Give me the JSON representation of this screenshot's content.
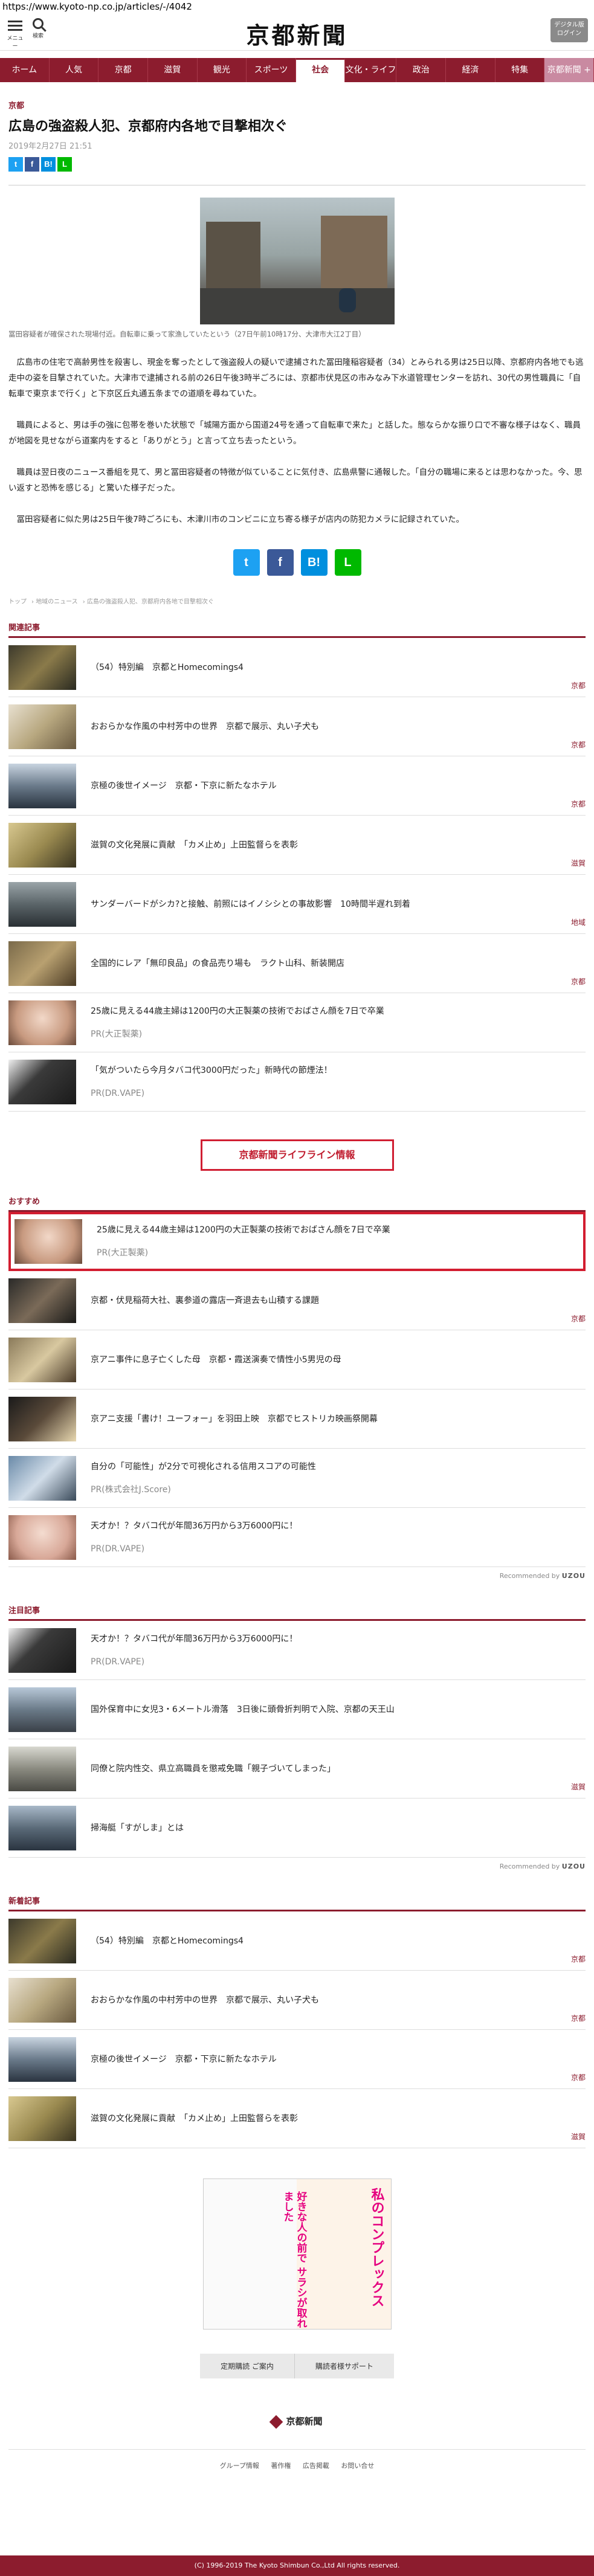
{
  "url": "https://www.kyoto-np.co.jp/articles/-/4042",
  "header": {
    "menu_label": "メニュー",
    "search_label": "検索",
    "logo": "京都新聞",
    "digital_label_1": "デジタル版",
    "digital_label_2": "ログイン"
  },
  "nav": [
    {
      "label": "ホーム"
    },
    {
      "label": "人気"
    },
    {
      "label": "京都"
    },
    {
      "label": "滋賀"
    },
    {
      "label": "観光"
    },
    {
      "label": "スポーツ"
    },
    {
      "label": "社会"
    },
    {
      "label": "文化・ライフ"
    },
    {
      "label": "政治"
    },
    {
      "label": "経済"
    },
    {
      "label": "特集"
    },
    {
      "label": "京都新聞 +"
    }
  ],
  "article": {
    "section": "京都",
    "title": "広島の強盗殺人犯、京都府内各地で目撃相次ぐ",
    "date": "2019年2月27日 21:51",
    "caption": "冨田容疑者が確保された現場付近。自転車に乗って家漁していたという（27日午前10時17分、大津市大江2丁目）",
    "paragraphs": [
      "広島市の住宅で高齢男性を殺害し、現金を奪ったとして強盗殺人の疑いで逮捕された冨田隆稲容疑者（34）とみられる男は25日以降、京都府内各地でも逃走中の姿を目撃されていた。大津市で逮捕される前の26日午後3時半ごろには、京都市伏見区の市みなみ下水道管理センターを訪れ、30代の男性職員に「自転車で東京まで行く」と下京区丘丸通五条までの道順を尋ねていた。",
      "職員によると、男は手の強に包帯を巻いた状態で「城陽方面から国道24号を通って自転車で来た」と話した。態ならかな振り口で不審な様子はなく、職員が地図を見せながら道案内をすると「ありがとう」と言って立ち去ったという。",
      "職員は翌日夜のニュース番組を見て、男と冨田容疑者の特徴が似ていることに気付き、広島県警に通報した。「自分の職場に来るとは思わなかった。今、思い返すと恐怖を感じる」と驚いた様子だった。",
      "冨田容疑者に似た男は25日午後7時ごろにも、木津川市のコンビニに立ち寄る様子が店内の防犯カメラに記録されていた。"
    ]
  },
  "share": {
    "twitter": "t",
    "facebook": "f",
    "hatena": "B!",
    "line": "L"
  },
  "breadcrumb": [
    "トップ",
    "地域のニュース",
    "広島の強盗殺人犯、京都府内各地で目撃相次ぐ"
  ],
  "related": {
    "label": "関連記事",
    "items": [
      {
        "title": "（54）特別編　京都とHomecomings4",
        "category": "京都"
      },
      {
        "title": "おおらかな作風の中村芳中の世界　京都で展示、丸い子犬も",
        "category": "京都"
      },
      {
        "title": "京極の後世イメージ　京都・下京に新たなホテル",
        "category": "京都"
      },
      {
        "title": "滋賀の文化発展に貢献　「カメ止め」上田監督らを表彰",
        "category": "滋賀"
      },
      {
        "title": "サンダーバードがシカ?と接触、前照にはイノシシとの事故影響　10時間半遅れ到着",
        "category": "地域"
      },
      {
        "title": "全国的にレア「無印良品」の食品売り場も　ラクト山科、新装開店",
        "category": "京都"
      },
      {
        "title": "25歳に見える44歳主婦は1200円の大正製薬の技術でおばさん顔を7日で卒業",
        "pr": "PR(大正製薬)"
      },
      {
        "title": "「気がついたら今月タバコ代3000円だった」新時代の節煙法！",
        "pr": "PR(DR.VAPE)"
      }
    ]
  },
  "lifeline_label": "京都新聞ライフライン情報",
  "osusume": {
    "label": "おすすめ",
    "items": [
      {
        "title": "25歳に見える44歳主婦は1200円の大正製薬の技術でおばさん顔を7日で卒業",
        "pr": "PR(大正製薬)"
      },
      {
        "title": "京都・伏見稲荷大社、裏参道の露店一斉退去も山積する課題",
        "category": "京都"
      },
      {
        "title": "京アニ事件に息子亡くした母　京都・霞送演奏で情性小5男児の母",
        "category": ""
      },
      {
        "title": "京アニ支援「書け！ユーフォー」を羽田上映　京都でヒストリカ映画祭開幕",
        "category": ""
      },
      {
        "title": "自分の「可能性」が2分で可視化される信用スコアの可能性",
        "pr": "PR(株式会社J.Score)"
      },
      {
        "title": "天才か！？タバコ代が年間36万円から3万6000円に！",
        "pr": "PR(DR.VAPE)"
      }
    ],
    "recommended_by": "Recommended by",
    "recommended_brand": "UZOU"
  },
  "chumoku": {
    "label": "注目記事",
    "items": [
      {
        "title": "天才か！？タバコ代が年間36万円から3万6000円に！",
        "pr": "PR(DR.VAPE)"
      },
      {
        "title": "国外保育中に女児3・6メートル滑落　3日後に頭骨折判明で入院、京都の天王山",
        "category": ""
      },
      {
        "title": "同僚と院内性交、県立高職員を懲戒免職「親子づいてしまった」",
        "category": "滋賀"
      },
      {
        "title": "掃海艇「すがしま」とは",
        "category": ""
      }
    ],
    "recommended_by": "Recommended by",
    "recommended_brand": "UZOU"
  },
  "newest": {
    "label": "新着記事",
    "items": [
      {
        "title": "（54）特別編　京都とHomecomings4",
        "category": "京都"
      },
      {
        "title": "おおらかな作風の中村芳中の世界　京都で展示、丸い子犬も",
        "category": "京都"
      },
      {
        "title": "京極の後世イメージ　京都・下京に新たなホテル",
        "category": "京都"
      },
      {
        "title": "滋賀の文化発展に貢献　「カメ止め」上田監督らを表彰",
        "category": "滋賀"
      }
    ]
  },
  "ad": {
    "text_right": "私のコンプレックス",
    "text_left": "好きな人の前で\nサラシが取れました"
  },
  "buttons": [
    "定期購読 ご案内",
    "購読者様サポート"
  ],
  "footer": {
    "logo": "京都新聞",
    "links": [
      "グループ情報",
      "著作権",
      "広告掲載",
      "お問い合せ"
    ],
    "copyright": "(C) 1996-2019 The Kyoto Shimbun Co.,Ltd All rights reserved."
  }
}
